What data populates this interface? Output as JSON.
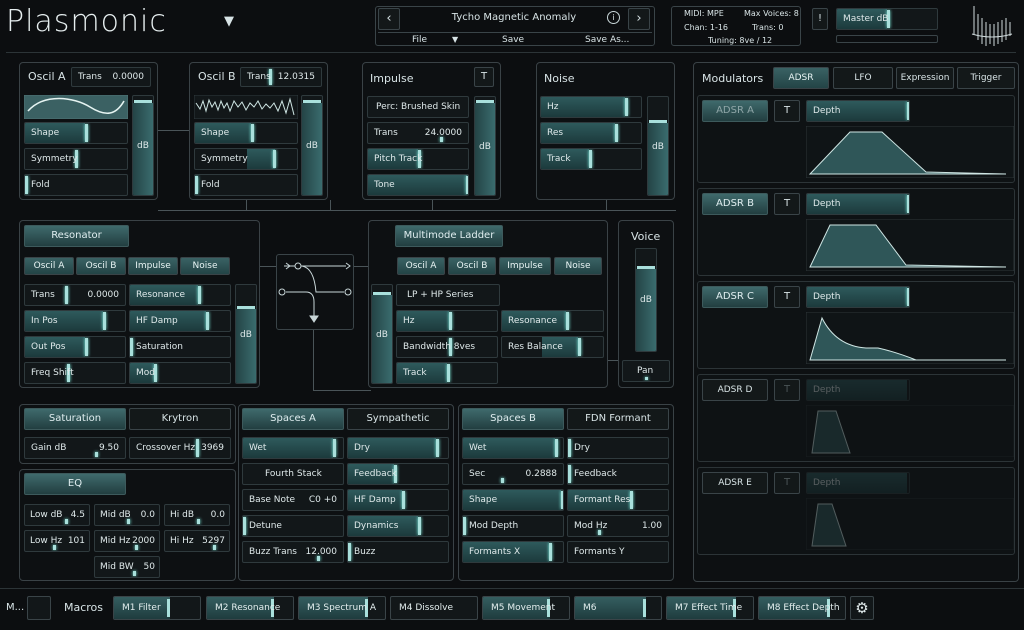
{
  "header": {
    "title": "Plasmonic",
    "dropdown_glyph": "▼",
    "preset": "Tycho Magnetic Anomaly",
    "file": "File",
    "save": "Save",
    "save_as": "Save As...",
    "midi": "MIDI: MPE",
    "max_voices": "Max Voices: 8",
    "chan": "Chan: 1-16",
    "trans": "Trans: 0",
    "tuning": "Tuning: 8ve / 12",
    "warn": "!",
    "master": "Master dB"
  },
  "oscil_a": {
    "title": "Oscil A",
    "trans_label": "Trans",
    "trans_value": "0.0000",
    "shape": "Shape",
    "symmetry": "Symmetry",
    "fold": "Fold",
    "db": "dB"
  },
  "oscil_b": {
    "title": "Oscil B",
    "trans_label": "Trans",
    "trans_value": "12.0315",
    "shape": "Shape",
    "symmetry": "Symmetry",
    "fold": "Fold",
    "db": "dB"
  },
  "impulse": {
    "title": "Impulse",
    "t": "T",
    "preset": "Perc: Brushed Skin",
    "trans_label": "Trans",
    "trans_value": "24.0000",
    "pitch_track": "Pitch Track",
    "tone": "Tone",
    "db": "dB"
  },
  "noise": {
    "title": "Noise",
    "hz": "Hz",
    "res": "Res",
    "track": "Track",
    "db": "dB"
  },
  "resonator": {
    "title": "Resonator",
    "src": [
      "Oscil A",
      "Oscil B",
      "Impulse",
      "Noise"
    ],
    "trans_label": "Trans",
    "trans_value": "0.0000",
    "resonance": "Resonance",
    "in_pos": "In Pos",
    "hf_damp": "HF Damp",
    "out_pos": "Out Pos",
    "saturation": "Saturation",
    "freq_shift": "Freq Shift",
    "mod": "Mod",
    "db": "dB"
  },
  "ladder": {
    "title": "Multimode Ladder",
    "src": [
      "Oscil A",
      "Oscil B",
      "Impulse",
      "Noise"
    ],
    "mode": "LP + HP Series",
    "hz": "Hz",
    "resonance": "Resonance",
    "bandwidth": "Bandwidth 8ves",
    "res_balance": "Res Balance",
    "track": "Track",
    "db": "dB"
  },
  "voice": {
    "title": "Voice",
    "db": "dB",
    "pan": "Pan"
  },
  "saturation": {
    "title": "Saturation",
    "type": "Krytron",
    "gain_label": "Gain dB",
    "gain_value": "9.50",
    "crossover_label": "Crossover Hz",
    "crossover_value": "3969"
  },
  "eq": {
    "title": "EQ",
    "low_db": "Low dB",
    "low_db_v": "4.5",
    "mid_db": "Mid dB",
    "mid_db_v": "0.0",
    "hi_db": "Hi dB",
    "hi_db_v": "0.0",
    "low_hz": "Low Hz",
    "low_hz_v": "101",
    "mid_hz": "Mid Hz",
    "mid_hz_v": "2000",
    "hi_hz": "Hi Hz",
    "hi_hz_v": "5297",
    "mid_bw": "Mid BW",
    "mid_bw_v": "50"
  },
  "spaces_a": {
    "title": "Spaces A",
    "type": "Sympathetic",
    "wet": "Wet",
    "dry": "Dry",
    "fourth": "Fourth Stack",
    "feedback": "Feedback",
    "base_note": "Base Note",
    "base_note_v": "C0 +0",
    "hf_damp": "HF Damp",
    "detune": "Detune",
    "dynamics": "Dynamics",
    "buzz_trans": "Buzz Trans",
    "buzz_trans_v": "12.000",
    "buzz": "Buzz"
  },
  "spaces_b": {
    "title": "Spaces B",
    "type": "FDN Formant",
    "wet": "Wet",
    "dry": "Dry",
    "sec": "Sec",
    "sec_v": "0.2888",
    "feedback": "Feedback",
    "shape": "Shape",
    "formant_res": "Formant Res",
    "mod_depth": "Mod Depth",
    "mod_hz": "Mod Hz",
    "mod_hz_v": "1.00",
    "formants_x": "Formants X",
    "formants_y": "Formants Y"
  },
  "modulators": {
    "title": "Modulators",
    "tabs": [
      "ADSR",
      "LFO",
      "Expression",
      "Trigger"
    ],
    "t": "T",
    "depth": "Depth",
    "adsr": [
      {
        "name": "ADSR A"
      },
      {
        "name": "ADSR B"
      },
      {
        "name": "ADSR C"
      },
      {
        "name": "ADSR D"
      },
      {
        "name": "ADSR E"
      }
    ]
  },
  "footer": {
    "m": "M...",
    "macros": "Macros",
    "items": [
      {
        "label": "M1 Filter",
        "level": 0.65
      },
      {
        "label": "M2 Resonance",
        "level": 0.78
      },
      {
        "label": "M3 Spectrum A",
        "level": 0.8
      },
      {
        "label": "M4 Dissolve",
        "level": 0.0
      },
      {
        "label": "M5 Movement",
        "level": 0.78
      },
      {
        "label": "M6",
        "level": 0.82
      },
      {
        "label": "M7 Effect Time",
        "level": 0.8
      },
      {
        "label": "M8 Effect Depth",
        "level": 0.82
      }
    ]
  }
}
